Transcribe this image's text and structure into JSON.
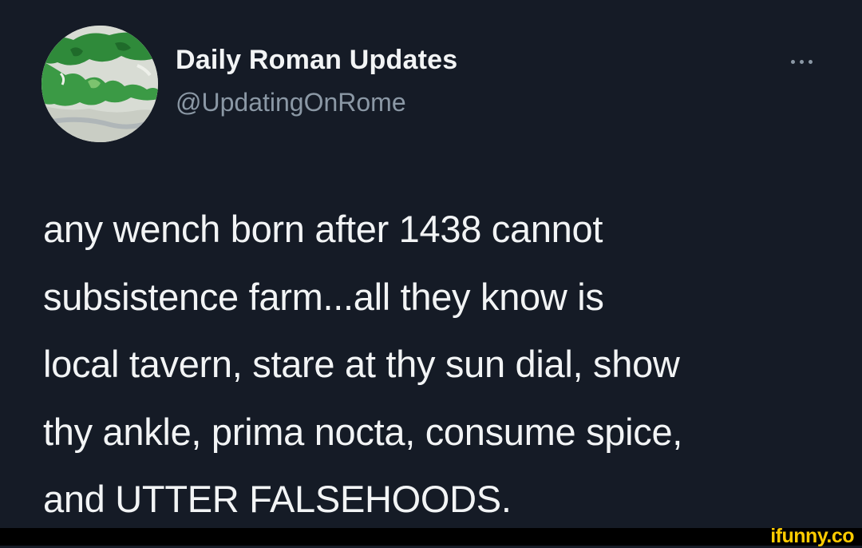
{
  "tweet": {
    "avatar_icon": "mediterranean-map-icon",
    "display_name": "Daily Roman Updates",
    "handle": "@UpdatingOnRome",
    "more_icon": "more-options-icon",
    "text": "any wench born after 1438 cannot\nsubsistence farm...all they know is\nlocal tavern, stare at thy sun dial, show\nthy ankle, prima nocta, consume spice,\nand UTTER FALSEHOODS."
  },
  "watermark": {
    "text": "ifunny.co"
  },
  "colors": {
    "background": "#151b26",
    "text_primary": "#f2f4f5",
    "text_secondary": "#8b98a5",
    "watermark": "#ffcc00"
  }
}
